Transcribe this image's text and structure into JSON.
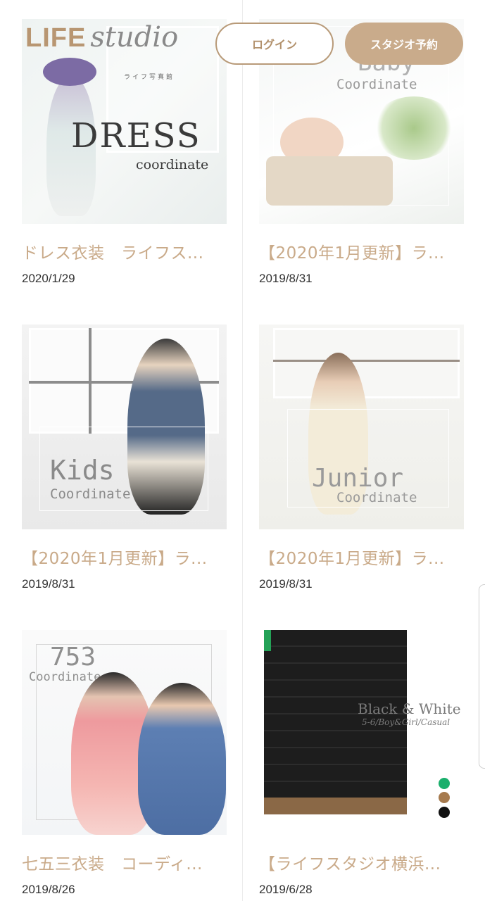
{
  "header": {
    "logo_main": "LIFE",
    "logo_script": "studio",
    "logo_sub": "ライフ写真館",
    "login_label": "ログイン",
    "reserve_label": "スタジオ予約"
  },
  "cards": [
    {
      "title": "ドレス衣装　ライフス...",
      "date": "2020/1/29",
      "image_text": {
        "main": "DRESS",
        "sub": "coordinate"
      }
    },
    {
      "title": "【2020年1月更新】ラ...",
      "date": "2019/8/31",
      "image_text": {
        "main": "Baby",
        "sub": "Coordinate"
      }
    },
    {
      "title": "【2020年1月更新】ラ...",
      "date": "2019/8/31",
      "image_text": {
        "main": "Kids",
        "sub": "Coordinate"
      }
    },
    {
      "title": "【2020年1月更新】ラ...",
      "date": "2019/8/31",
      "image_text": {
        "main": "Junior",
        "sub": "Coordinate"
      }
    },
    {
      "title": "七五三衣装　コーディ...",
      "date": "2019/8/26",
      "image_text": {
        "main": "753",
        "sub": "Coordinate"
      }
    },
    {
      "title": "【ライフスタジオ横浜...",
      "date": "2019/6/28",
      "image_text": {
        "main": "Black & White",
        "sub": "5-6/Boy&Girl/Casual"
      }
    }
  ],
  "colors": {
    "accent": "#c9ab8b",
    "title_text": "#c9aa89",
    "swatches": [
      "#1aaf6c",
      "#a67a4e",
      "#111111"
    ]
  }
}
